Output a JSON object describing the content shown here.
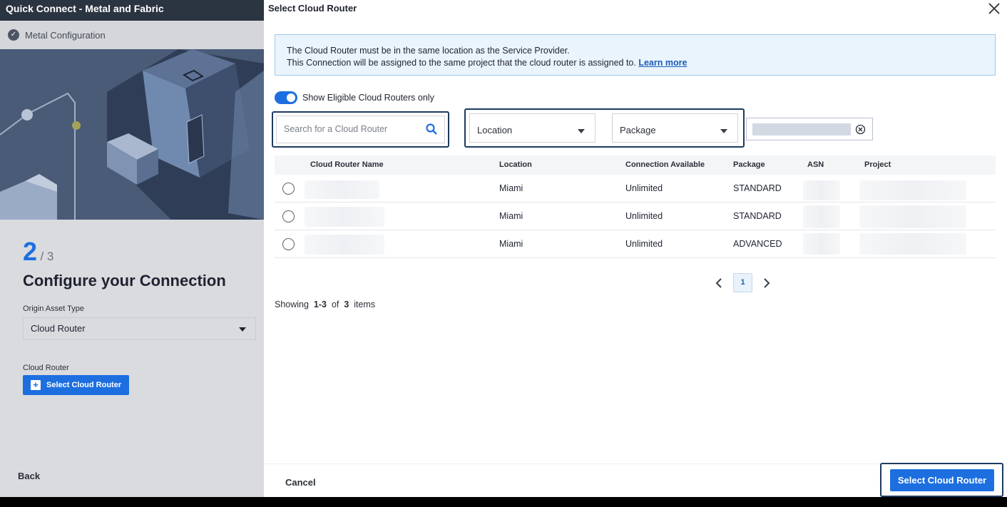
{
  "left_panel": {
    "window_title": "Quick Connect - Metal and Fabric",
    "step_bar_label": "Metal Configuration",
    "step_current": "2",
    "step_total": "/ 3",
    "heading": "Configure your Connection",
    "origin_asset_type_label": "Origin Asset Type",
    "origin_asset_type_value": "Cloud Router",
    "cloud_router_label": "Cloud Router",
    "select_cloud_router_button": "Select Cloud Router",
    "back_button": "Back"
  },
  "modal": {
    "title": "Select Cloud Router",
    "info_line1": "The Cloud Router must be in the same location as the Service Provider.",
    "info_line2": "This Connection will be assigned to the same project that the cloud router is assigned to.",
    "learn_more": "Learn more",
    "toggle_label": "Show Eligible Cloud Routers only",
    "toggle_on": true,
    "search_placeholder": "Search for a Cloud Router",
    "filter_location": "Location",
    "filter_package": "Package",
    "table": {
      "headers": [
        "Cloud Router Name",
        "Location",
        "Connection Available",
        "Package",
        "ASN",
        "Project"
      ],
      "rows": [
        {
          "location": "Miami",
          "connection": "Unlimited",
          "package": "STANDARD"
        },
        {
          "location": "Miami",
          "connection": "Unlimited",
          "package": "STANDARD"
        },
        {
          "location": "Miami",
          "connection": "Unlimited",
          "package": "ADVANCED"
        }
      ]
    },
    "pagination": {
      "current_page": "1"
    },
    "showing": {
      "prefix": "Showing",
      "range": "1-3",
      "of": "of",
      "total": "3",
      "suffix": "items"
    },
    "cancel_button": "Cancel",
    "select_button": "Select Cloud Router"
  },
  "colors": {
    "accent": "#1d6fe0",
    "focus_outline": "#1e3a5f",
    "info_background": "#eaf4fd"
  }
}
